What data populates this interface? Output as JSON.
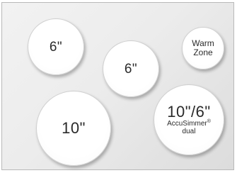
{
  "zones": {
    "top_left": {
      "size": "6\""
    },
    "center": {
      "size": "6\""
    },
    "warm": {
      "line1": "Warm",
      "line2": "Zone"
    },
    "bottom_left": {
      "size": "10\""
    },
    "accu": {
      "size": "10\"/6\"",
      "sub1": "AccuSimmer",
      "reg": "®",
      "sub2": "dual"
    }
  }
}
